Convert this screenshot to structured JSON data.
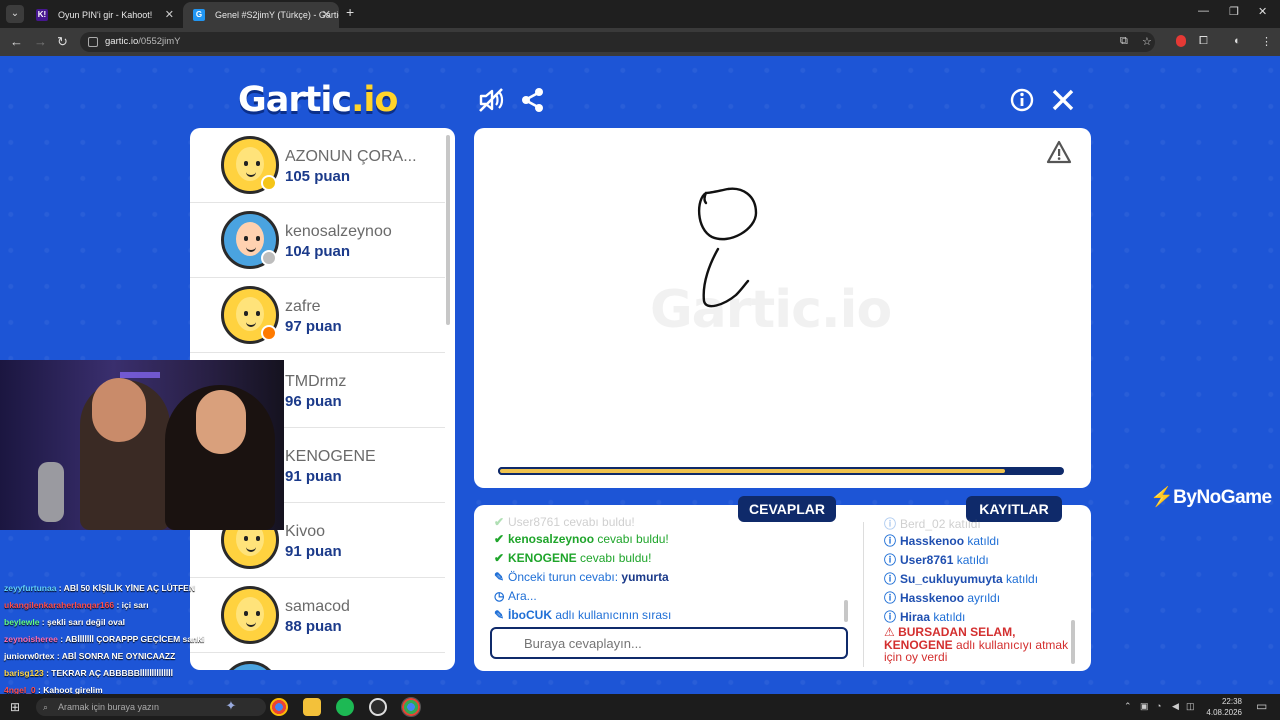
{
  "browser": {
    "tabs": [
      {
        "label": "Oyun PIN'i gir - Kahoot!",
        "favicon": "K!"
      },
      {
        "label": "Genel #S2jimY (Türkçe) - Gartic",
        "favicon": "G"
      }
    ],
    "url_domain": "gartic.io",
    "url_path": "/0552jimY"
  },
  "game": {
    "logo_main": "Gartic",
    "logo_suffix": ".io",
    "watermark": "Gartic.io",
    "players": [
      {
        "name": "AZONUN ÇORA...",
        "points": "105 puan",
        "status_color": "#f5c518"
      },
      {
        "name": "kenosalzeynoo",
        "points": "104 puan",
        "status_color": "#bdbdbd"
      },
      {
        "name": "zafre",
        "points": "97 puan",
        "status_color": "#ff7a00"
      },
      {
        "name": "TMDrmz",
        "points": "96 puan",
        "status_color": ""
      },
      {
        "name": "KENOGENE",
        "points": "91 puan",
        "status_color": ""
      },
      {
        "name": "Kivoo",
        "points": "91 puan",
        "status_color": ""
      },
      {
        "name": "samacod",
        "points": "88 puan",
        "status_color": ""
      }
    ],
    "timer_progress": 0.9
  },
  "answers_tab": "CEVAPLAR",
  "logs_tab": "KAYITLAR",
  "answers": {
    "faded_line": "User8761 cevabı buldu!",
    "line1_name": "kenosalzeynoo",
    "line1_rest": " cevabı buldu!",
    "line2_name": "KENOGENE",
    "line2_rest": " cevabı buldu!",
    "line3_text": "Önceki turun cevabı: ",
    "line3_word": "yumurta",
    "line4_text": "Ara...",
    "line5_name": "İboCUK",
    "line5_rest": " adlı kullanıcının sırası",
    "input_placeholder": "Buraya cevaplayın..."
  },
  "logs": {
    "faded_line": "Berd_02 katıldı",
    "entries": [
      {
        "name": "Hasskenoo",
        "action": " katıldı"
      },
      {
        "name": "User8761",
        "action": " katıldı"
      },
      {
        "name": "Su_cukluyumuyta",
        "action": " katıldı"
      },
      {
        "name": "Hasskenoo",
        "action": " ayrıldı"
      },
      {
        "name": "Hiraa",
        "action": " katıldı"
      }
    ],
    "warn_bold1": "BURSADAN SELAM,",
    "warn_bold2": "KENOGENE",
    "warn_rest": " adlı kullanıcıyı atmak için oy verdi"
  },
  "sponsor": "ByNoGame",
  "stream_chat": [
    {
      "user": "zeyyfurtunaa",
      "msg": " : ABİ 50 KİŞİLİK YİNE AÇ LÜTFEN",
      "color": "#62d2ff"
    },
    {
      "user": "ukangilenkaraherlanqar166",
      "msg": " : içi sarı",
      "color": "#ff4d4d"
    },
    {
      "user": "beylewle",
      "msg": " : şekli sarı değil oval",
      "color": "#63ff8a"
    },
    {
      "user": "zeynoisheree",
      "msg": " : ABİİİİİİİ ÇORAPPP GEÇİCEM sanki",
      "color": "#ff6fb4"
    },
    {
      "user": "juniorw0rtex",
      "msg": " : ABİ SONRA NE OYNICAAZZ",
      "color": "#ffffff"
    },
    {
      "user": "barisg123",
      "msg": " : TEKRAR AÇ ABBBBBİİİİİİİİİİİİİİ",
      "color": "#ffd84d"
    },
    {
      "user": "4ngel_0",
      "msg": " : Kahoot girelim",
      "color": "#ff4d4d"
    },
    {
      "user": "zeyyfurtunaa",
      "msg": " : ABİ 50 KİŞİLİK YİNE AÇ LÜTFEN",
      "color": "#62d2ff"
    }
  ],
  "taskbar": {
    "search_placeholder": "Aramak için buraya yazın",
    "time": "22:38",
    "date": "4.08.2026"
  },
  "colors": {
    "bg_blue": "#1d55d6",
    "navy": "#0f2a6a",
    "found_green": "#1fa52b",
    "timer_gold": "#f0c34e"
  }
}
